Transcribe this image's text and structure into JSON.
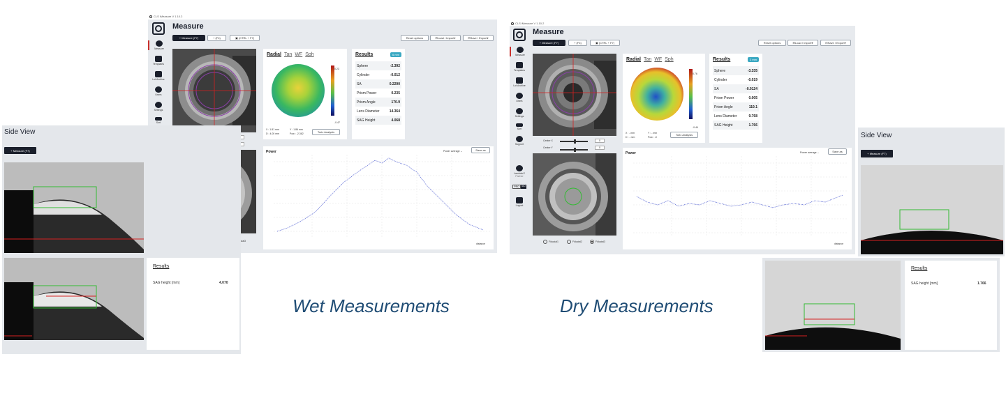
{
  "app_title": "CLS iMeasure V 1.10.2",
  "nav": {
    "items": [
      {
        "label": "Measure"
      },
      {
        "label": "Templates"
      },
      {
        "label": "Lot Archive"
      },
      {
        "label": "Users"
      },
      {
        "label": "Settings"
      },
      {
        "label": "Sort"
      },
      {
        "label": "Support"
      }
    ],
    "user_name": "Lambda E",
    "user_role": "Partner",
    "toggle_pro": "PRO",
    "toggle_sid": "SID",
    "logout": "Log out",
    "logout_dry": "Logout"
  },
  "toolbar": {
    "title": "Measure",
    "measure": "Measure (F7)",
    "f4": "(F4)",
    "ctrl": "(CTRL + F7)",
    "reset": "Reset options",
    "load": "Load / Import",
    "save": "Save / Export"
  },
  "map_tabs": [
    "Radial",
    "Tan",
    "WF",
    "Sph"
  ],
  "center": {
    "x_label": "Center X",
    "y_label": "Center Y",
    "x_val": "0",
    "y_val": "0"
  },
  "toric_button": "Toric Analysis",
  "profile": {
    "label": "Power",
    "average": "Power average",
    "save_as": "Save as",
    "x_axis": "distance"
  },
  "radio": [
    "Fiducial1",
    "Fiducial2",
    "Fiducial3"
  ],
  "wet": {
    "badge": "6 mm",
    "results_title": "Results",
    "rows": [
      {
        "k": "Sphere",
        "v": "-2.392"
      },
      {
        "k": "Cylinder",
        "v": "-0.012"
      },
      {
        "k": "SA",
        "v": "0.2290"
      },
      {
        "k": "Prism Power",
        "v": "0.235"
      },
      {
        "k": "Prism Angle",
        "v": "170.9"
      },
      {
        "k": "Lens Diameter",
        "v": "14.364"
      },
      {
        "k": "SAG Height",
        "v": "4.068"
      }
    ],
    "coord_x": "X : 1.81 mm",
    "coord_y": "Y : 1.86 mm",
    "coord_d": "D : 4.00 mm",
    "coord_pow": "Pow : -2.362",
    "scale_top": "0.23",
    "scale_bot": "-0.47",
    "side_sag_label": "SAG height [mm]",
    "side_sag_value": "4.070",
    "caption": "Wet Measurements"
  },
  "dry": {
    "badge": "2 mm",
    "results_title": "Results",
    "rows": [
      {
        "k": "Sphere",
        "v": "-3.335"
      },
      {
        "k": "Cylinder",
        "v": "-0.019"
      },
      {
        "k": "SA",
        "v": "-0.0124"
      },
      {
        "k": "Prism Power",
        "v": "0.005"
      },
      {
        "k": "Prism Angle",
        "v": "119.1"
      },
      {
        "k": "Lens Diameter",
        "v": "9.768"
      },
      {
        "k": "SAG Height",
        "v": "1.766"
      }
    ],
    "coord_x": "X : - mm",
    "coord_y": "Y : - mm",
    "coord_d": "D : - mm",
    "coord_pow": "Pow : -0",
    "scale_top": "0.76",
    "scale_bot": "-0.44",
    "side_sag_label": "SAG height [mm]",
    "side_sag_value": "1.766",
    "caption": "Dry Measurements"
  },
  "side_view": {
    "title": "Side View",
    "measure": "Measure (F7)",
    "results": "Results"
  },
  "colors": {
    "dark": "#1a1f2b",
    "accent": "#c9302c",
    "badge": "#3aa8c2",
    "caption": "#1f4c74"
  },
  "icons": [
    "plus-icon",
    "crosshair-icon",
    "document-icon",
    "archive-icon",
    "users-icon",
    "gear-icon",
    "sort-icon",
    "help-icon",
    "user-icon",
    "logout-icon",
    "save-icon",
    "folder-icon"
  ]
}
